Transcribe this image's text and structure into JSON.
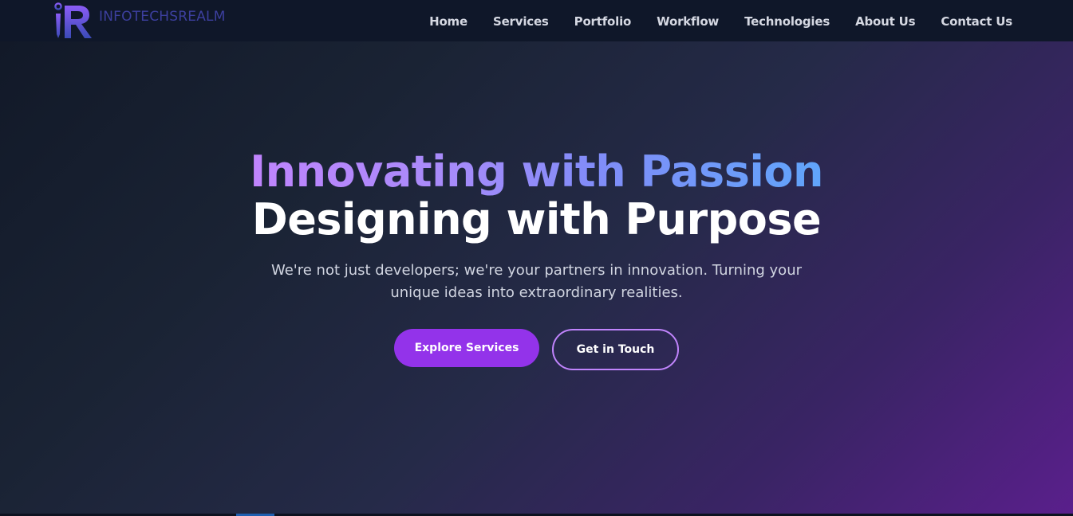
{
  "brand": {
    "name": "INFOTECHSREALM",
    "logo_icon": "ir-monogram-icon"
  },
  "nav": {
    "items": [
      {
        "label": "Home"
      },
      {
        "label": "Services"
      },
      {
        "label": "Portfolio"
      },
      {
        "label": "Workflow"
      },
      {
        "label": "Technologies"
      },
      {
        "label": "About Us"
      },
      {
        "label": "Contact Us"
      }
    ]
  },
  "hero": {
    "headline_gradient": "Innovating with Passion",
    "headline_solid": "Designing with Purpose",
    "subtitle": "We're not just developers; we're your partners in innovation. Turning your unique ideas into extraordinary realities.",
    "primary_cta": "Explore Services",
    "secondary_cta": "Get in Touch"
  },
  "colors": {
    "nav_bg": "#0f1729",
    "accent_purple": "#9333ea",
    "outline_purple": "#c084fc",
    "gradient_start": "#c084fc",
    "gradient_end": "#60a5fa",
    "brand_blue": "#3c3f9e"
  }
}
